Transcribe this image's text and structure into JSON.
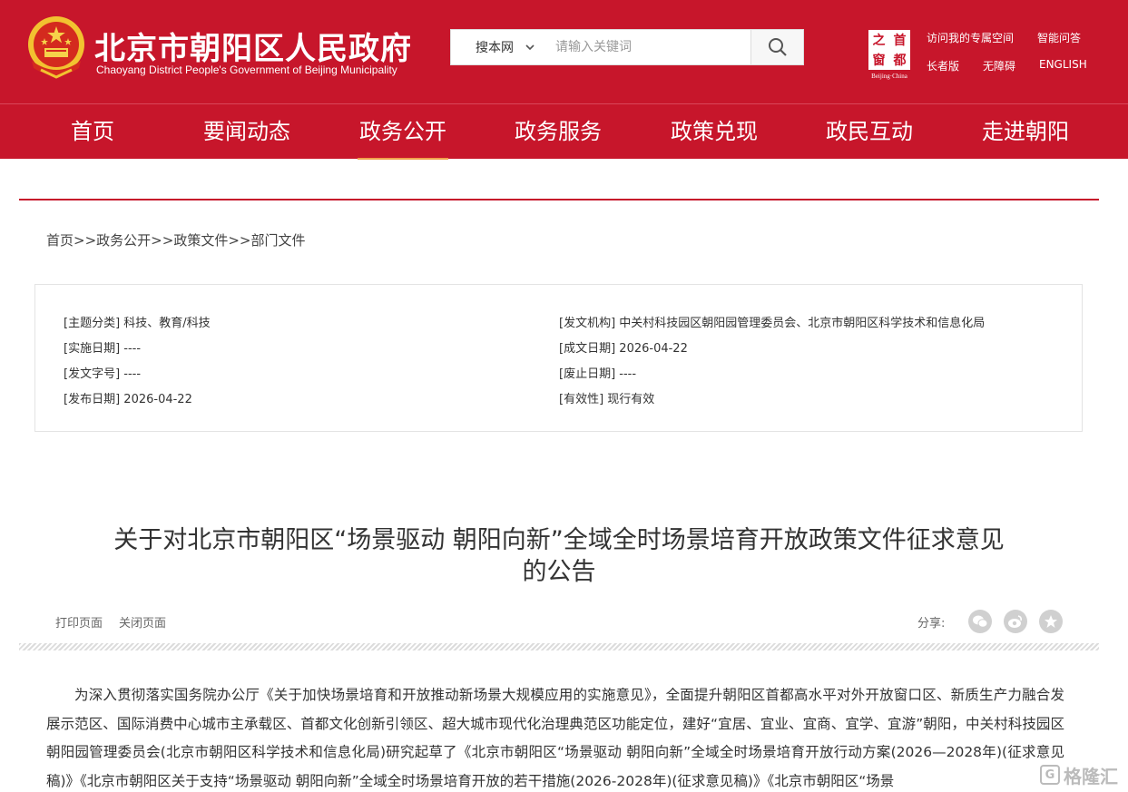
{
  "header": {
    "site_title": "北京市朝阳区人民政府",
    "site_subtitle": "Chaoyang District People's Government of Beijing Municipality",
    "search": {
      "scope_label": "搜本网",
      "placeholder": "请输入关键词"
    },
    "capital_logo": {
      "chars": [
        "之",
        "首",
        "窗",
        "都"
      ],
      "caption": "Beijing·China"
    },
    "top_links": {
      "my_space": "访问我的专属空间",
      "smart_qa": "智能问答",
      "elder_mode": "长者版",
      "accessibility": "无障碍",
      "english": "ENGLISH"
    },
    "colors": {
      "brand_red": "#c7162b",
      "active_underline": "#f0a04b"
    }
  },
  "nav": {
    "items": [
      "首页",
      "要闻动态",
      "政务公开",
      "政务服务",
      "政策兑现",
      "政民互动",
      "走进朝阳"
    ],
    "active_item": "政务公开"
  },
  "breadcrumb": {
    "items": [
      "首页",
      "政务公开",
      "政策文件",
      "部门文件"
    ],
    "separator": ">>"
  },
  "meta": {
    "topic": {
      "key": "[主题分类]",
      "value": "科技、教育/科技"
    },
    "issuer": {
      "key": "[发文机构]",
      "value": "中关村科技园区朝阳园管理委员会、北京市朝阳区科学技术和信息化局"
    },
    "effective_date": {
      "key": "[实施日期]",
      "value": "----"
    },
    "created_date": {
      "key": "[成文日期]",
      "value": "2026-04-22"
    },
    "doc_number": {
      "key": "[发文字号]",
      "value": "----"
    },
    "repeal_date": {
      "key": "[废止日期]",
      "value": "----"
    },
    "publish_date": {
      "key": "[发布日期]",
      "value": "2026-04-22"
    },
    "validity": {
      "key": "[有效性]",
      "value": "现行有效"
    }
  },
  "article": {
    "title_line1": "关于对北京市朝阳区“场景驱动 朝阳向新”全域全时场景培育开放政策文件征求意见",
    "title_line2": "的公告",
    "print_label": "打印页面",
    "close_label": "关闭页面",
    "share_label": "分享:",
    "share_icons": [
      "wechat-icon",
      "weibo-icon",
      "favorite-icon"
    ],
    "body_paragraph": "为深入贯彻落实国务院办公厅《关于加快场景培育和开放推动新场景大规模应用的实施意见》，全面提升朝阳区首都高水平对外开放窗口区、新质生产力融合发展示范区、国际消费中心城市主承载区、首都文化创新引领区、超大城市现代化治理典范区功能定位，建好“宜居、宜业、宜商、宜学、宜游”朝阳，中关村科技园区朝阳园管理委员会(北京市朝阳区科学技术和信息化局)研究起草了《北京市朝阳区“场景驱动 朝阳向新”全域全时场景培育开放行动方案(2026—2028年)(征求意见稿)》《北京市朝阳区关于支持“场景驱动 朝阳向新”全域全时场景培育开放的若干措施(2026-2028年)(征求意见稿)》《北京市朝阳区“场景"
  },
  "watermark": {
    "text": "格隆汇",
    "glyph": "G"
  }
}
